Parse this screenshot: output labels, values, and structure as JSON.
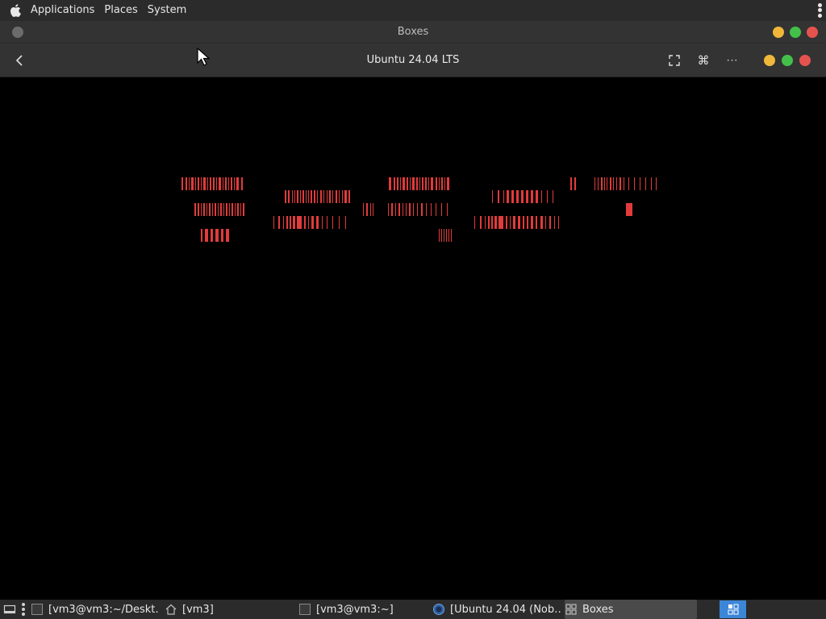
{
  "top_panel": {
    "logo_icon": "apple-icon",
    "menus": [
      "Applications",
      "Places",
      "System"
    ],
    "overflow_icon": "vertical-dots-icon"
  },
  "outer_window": {
    "title": "Boxes",
    "controls": {
      "minimize": "#f0b73a",
      "maximize": "#43c04a",
      "close": "#e5534f"
    }
  },
  "headerbar": {
    "back_icon": "chevron-left-icon",
    "title": "Ubuntu 24.04 LTS",
    "fullscreen_icon": "fullscreen-icon",
    "keys_icon": "command-key-icon",
    "menu_icon": "ellipsis-icon"
  },
  "vm_display": {
    "description_color": "#e23b3b"
  },
  "taskbar": {
    "items": [
      {
        "label": "[vm3@vm3:~/Deskt…",
        "icon": "terminal-icon"
      },
      {
        "label": "[vm3]",
        "icon": "home-folder-icon"
      },
      {
        "label": "[vm3@vm3:~]",
        "icon": "terminal-icon"
      },
      {
        "label": "[Ubuntu 24.04 (Nob…",
        "icon": "browser-icon"
      },
      {
        "label": "Boxes",
        "icon": "boxes-icon"
      }
    ],
    "workspace_icon": "workspace-switcher-icon"
  }
}
